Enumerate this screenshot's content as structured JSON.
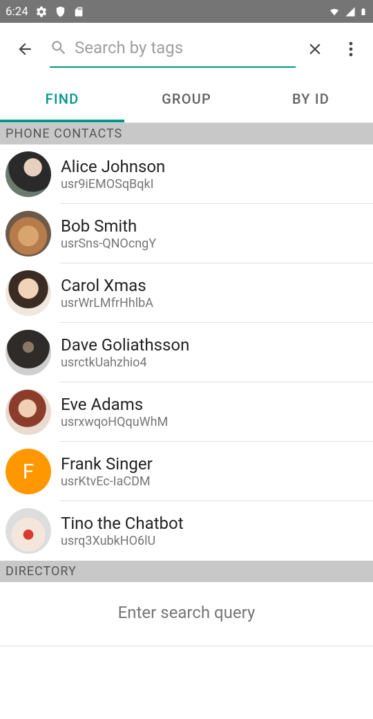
{
  "status_bar": {
    "time": "6:24",
    "icons": [
      "gear-icon",
      "shield-icon",
      "sd-card-icon",
      "wifi-icon",
      "signal-icon",
      "battery-icon"
    ]
  },
  "app_bar": {
    "search_placeholder": "Search by tags"
  },
  "tabs": [
    {
      "label": "FIND",
      "active": true
    },
    {
      "label": "GROUP",
      "active": false
    },
    {
      "label": "BY ID",
      "active": false
    }
  ],
  "sections": {
    "phone_contacts_label": "PHONE CONTACTS",
    "directory_label": "DIRECTORY",
    "directory_placeholder": "Enter search query"
  },
  "contacts": [
    {
      "name": "Alice Johnson",
      "id": "usr9iEMOSqBqkI",
      "avatar_class": "av-1",
      "initial": ""
    },
    {
      "name": "Bob Smith",
      "id": "usrSns-QNOcngY",
      "avatar_class": "av-2",
      "initial": ""
    },
    {
      "name": "Carol Xmas",
      "id": "usrWrLMfrHhlbA",
      "avatar_class": "av-3",
      "initial": ""
    },
    {
      "name": "Dave Goliathsson",
      "id": "usrctkUahzhio4",
      "avatar_class": "av-4",
      "initial": ""
    },
    {
      "name": "Eve Adams",
      "id": "usrxwqoHQquWhM",
      "avatar_class": "av-5",
      "initial": ""
    },
    {
      "name": "Frank Singer",
      "id": "usrKtvEc-IaCDM",
      "avatar_class": "av-6",
      "initial": "F"
    },
    {
      "name": "Tino the Chatbot",
      "id": "usrq3XubkHO6lU",
      "avatar_class": "av-7",
      "initial": ""
    }
  ]
}
